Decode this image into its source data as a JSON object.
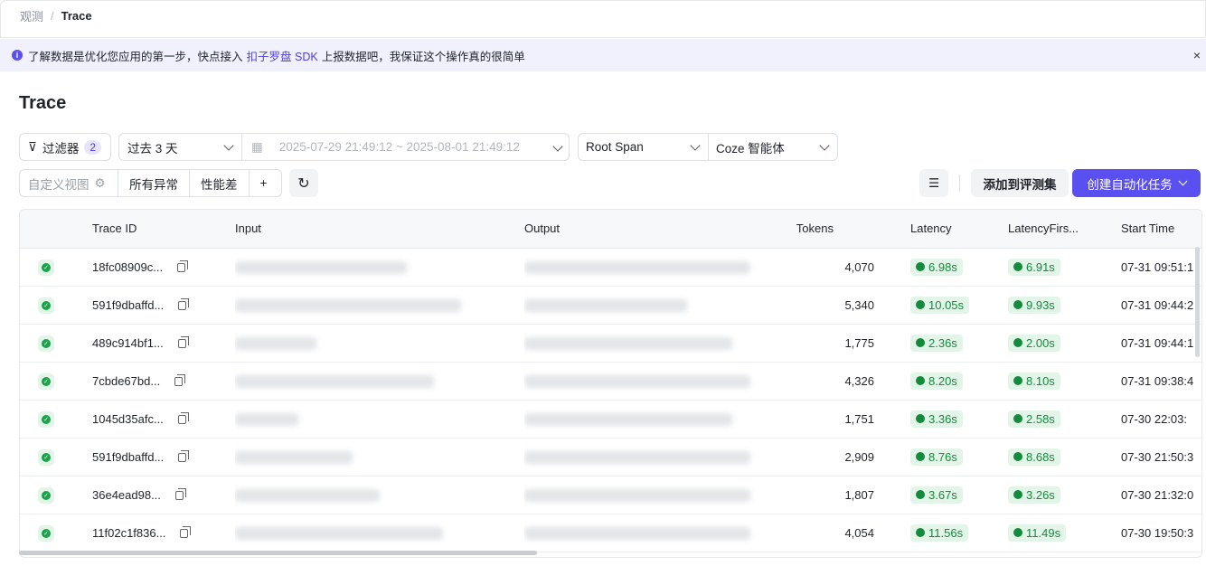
{
  "breadcrumb": {
    "parent": "观测",
    "separator": "/",
    "current": "Trace"
  },
  "banner": {
    "text_before": "了解数据是优化您应用的第一步，快点接入",
    "link": "扣子罗盘 SDK",
    "text_after": "上报数据吧，我保证这个操作真的很简单",
    "close": "×"
  },
  "page_title": "Trace",
  "toolbar": {
    "filter_label": "过滤器",
    "filter_count": "2",
    "time_preset": "过去 3 天",
    "time_range": "2025-07-29 21:49:12 ~ 2025-08-01 21:49:12",
    "span_type": "Root Span",
    "agent_type": "Coze 智能体",
    "custom_view_placeholder": "自定义视图",
    "view_all_errors": "所有异常",
    "view_poor_perf": "性能差",
    "add_view": "+",
    "refresh": "↻",
    "add_to_eval": "添加到评测集",
    "create_task": "创建自动化任务"
  },
  "table": {
    "columns": [
      "",
      "Trace ID",
      "Input",
      "Output",
      "Tokens",
      "Latency",
      "LatencyFirs...",
      "Start Time"
    ],
    "rows": [
      {
        "id": "18fc08909c...",
        "tokens": "4,070",
        "latency": "6.98s",
        "first": "6.91s",
        "start": "07-31 09:51:1"
      },
      {
        "id": "591f9dbaffd...",
        "tokens": "5,340",
        "latency": "10.05s",
        "first": "9.93s",
        "start": "07-31 09:44:2"
      },
      {
        "id": "489c914bf1...",
        "tokens": "1,775",
        "latency": "2.36s",
        "first": "2.00s",
        "start": "07-31 09:44:1"
      },
      {
        "id": "7cbde67bd...",
        "tokens": "4,326",
        "latency": "8.20s",
        "first": "8.10s",
        "start": "07-31 09:38:4"
      },
      {
        "id": "1045d35afc...",
        "tokens": "1,751",
        "latency": "3.36s",
        "first": "2.58s",
        "start": "07-30 22:03:"
      },
      {
        "id": "591f9dbaffd...",
        "tokens": "2,909",
        "latency": "8.76s",
        "first": "8.68s",
        "start": "07-30 21:50:3"
      },
      {
        "id": "36e4ead98...",
        "tokens": "1,807",
        "latency": "3.67s",
        "first": "3.26s",
        "start": "07-30 21:32:0"
      },
      {
        "id": "11f02c1f836...",
        "tokens": "4,054",
        "latency": "11.56s",
        "first": "11.49s",
        "start": "07-30 19:50:3"
      }
    ]
  },
  "colors": {
    "accent": "#5a4ff0",
    "success": "#148a3d",
    "banner_bg": "#f1f1fe"
  }
}
